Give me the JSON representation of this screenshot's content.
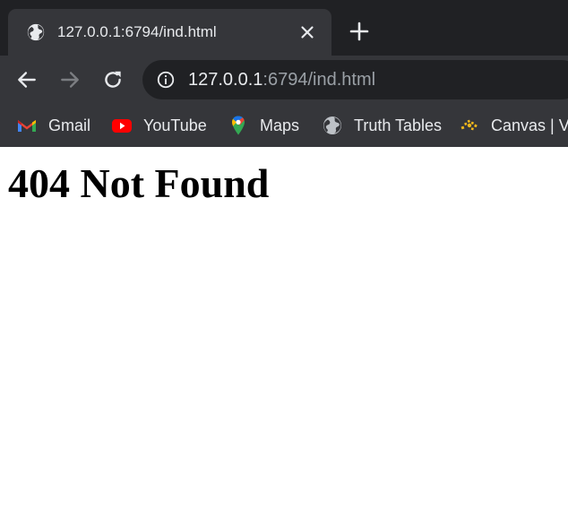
{
  "tab": {
    "title": "127.0.0.1:6794/ind.html",
    "favicon": "globe-icon",
    "close_icon": "close-icon"
  },
  "new_tab_icon": "plus-icon",
  "toolbar": {
    "back_icon": "arrow-left-icon",
    "forward_icon": "arrow-right-icon",
    "reload_icon": "reload-icon",
    "site_info_icon": "info-icon",
    "url_host": "127.0.0.1",
    "url_rest": ":6794/ind.html"
  },
  "bookmarks": [
    {
      "label": "Gmail",
      "icon": "gmail-icon"
    },
    {
      "label": "YouTube",
      "icon": "youtube-icon"
    },
    {
      "label": "Maps",
      "icon": "maps-icon"
    },
    {
      "label": "Truth Tables",
      "icon": "globe-icon"
    },
    {
      "label": "Canvas | Ve",
      "icon": "canvas-icon"
    }
  ],
  "page": {
    "heading": "404 Not Found"
  },
  "colors": {
    "tabstrip": "#202124",
    "toolbar": "#35363a",
    "omnibox": "#202124",
    "text_light": "#e8eaed",
    "text_dim": "#9aa0a6",
    "youtube_red": "#ff0000"
  }
}
